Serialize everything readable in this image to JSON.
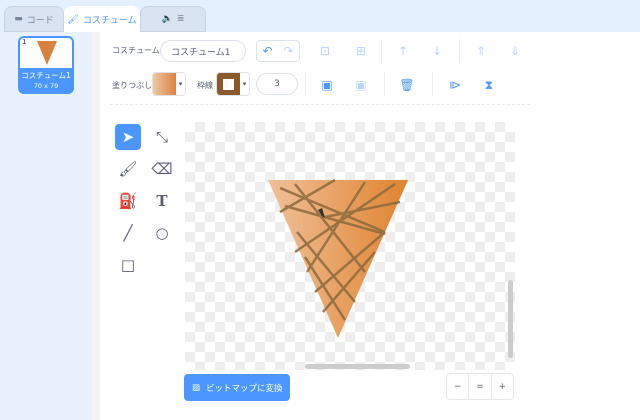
{
  "tabs": [
    {
      "label": "コード",
      "icon": "code-icon"
    },
    {
      "label": "コスチューム",
      "icon": "brush-icon"
    },
    {
      "label": "音",
      "icon": "sound-icon"
    }
  ],
  "costumes": [
    {
      "index": "1",
      "name": "コスチューム1",
      "size": "70 x 79"
    }
  ],
  "toolbar": {
    "costume_label": "コスチューム",
    "costume_name": "コスチューム1",
    "fill_label": "塗りつぶし",
    "outline_label": "枠線",
    "outline_width": "3",
    "fill_color": "#e08a4a",
    "outline_color": "#8a5a2b"
  },
  "convert_button": "ビットマップに変換",
  "zoom": {
    "out": "−",
    "reset": "=",
    "in": "+"
  },
  "colors": {
    "accent": "#4c97ff",
    "cone": "#e0894a",
    "cone_lines": "#8c6a3e"
  }
}
